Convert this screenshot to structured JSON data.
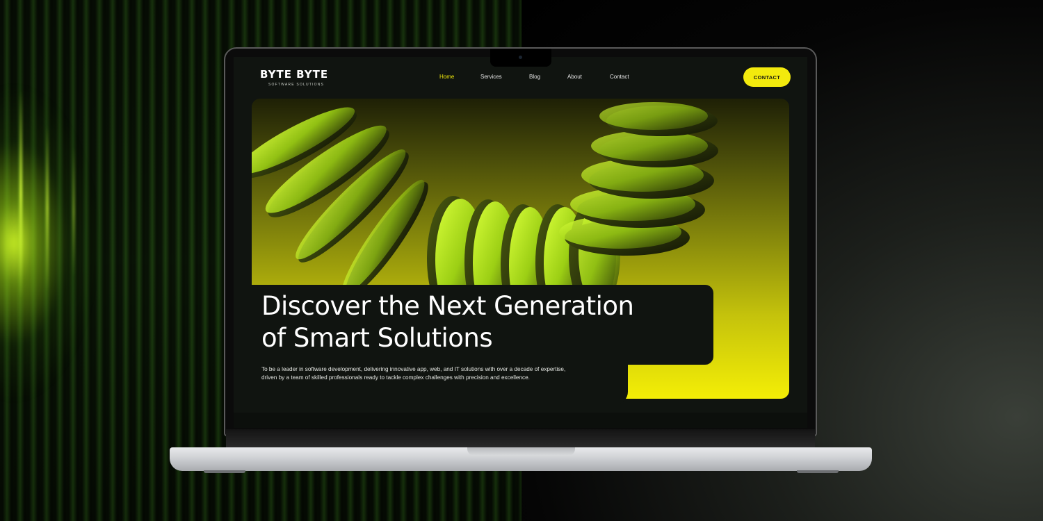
{
  "site": {
    "logo_title": "BYTE BYTE",
    "logo_subtitle": "SOFTWARE SOLUTIONS",
    "nav": [
      {
        "label": "Home",
        "active": true
      },
      {
        "label": "Services",
        "active": false
      },
      {
        "label": "Blog",
        "active": false
      },
      {
        "label": "About",
        "active": false
      },
      {
        "label": "Contact",
        "active": false
      }
    ],
    "cta_label": "CONTACT",
    "hero": {
      "headline_line1": "Discover the Next Generation",
      "headline_line2": "of Smart Solutions",
      "description": "To be a leader in software development, delivering innovative app, web, and IT solutions with over a decade of expertise, driven by a team of skilled professionals ready to tackle complex challenges with precision and excellence."
    }
  },
  "colors": {
    "accent": "#f3ea0d",
    "dark": "#101410",
    "text": "#ffffff"
  },
  "icons": [
    "camera-dot"
  ]
}
